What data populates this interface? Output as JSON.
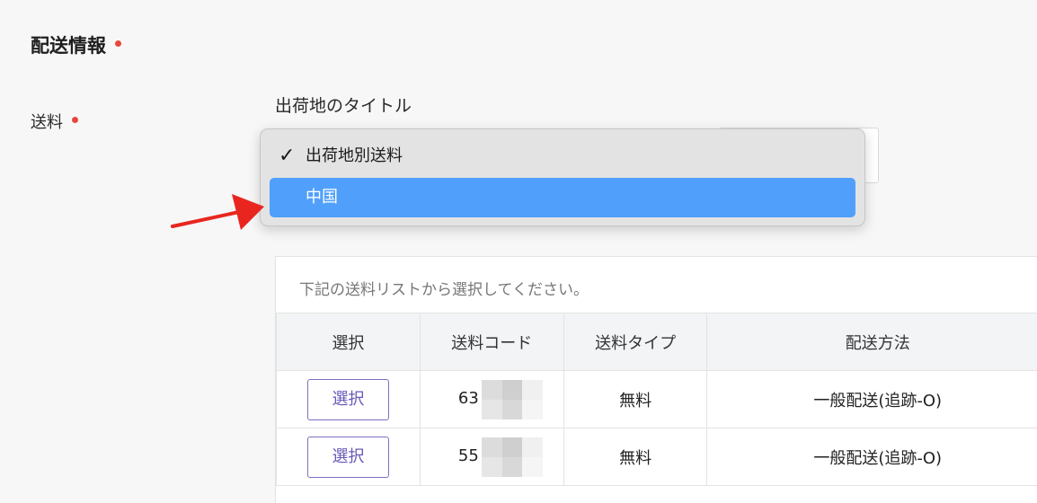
{
  "section": {
    "title": "配送情報"
  },
  "shipping_field": {
    "label": "送料"
  },
  "origin": {
    "title": "出荷地のタイトル"
  },
  "dropdown": {
    "options": [
      {
        "label": "出荷地別送料",
        "checked": true
      },
      {
        "label": "中国",
        "highlighted": true
      }
    ]
  },
  "list": {
    "hint": "下記の送料リストから選択してください。",
    "columns": [
      "選択",
      "送料コード",
      "送料タイプ",
      "配送方法"
    ],
    "rows": [
      {
        "select_label": "選択",
        "code": "63",
        "type": "無料",
        "method": "一般配送(追跡-O)"
      },
      {
        "select_label": "選択",
        "code": "55",
        "type": "無料",
        "method": "一般配送(追跡-O)"
      }
    ]
  },
  "colors": {
    "required_dot": "#e8473d",
    "highlight": "#50a0fb",
    "button_border": "#7b70c4",
    "arrow": "#e8261f"
  }
}
